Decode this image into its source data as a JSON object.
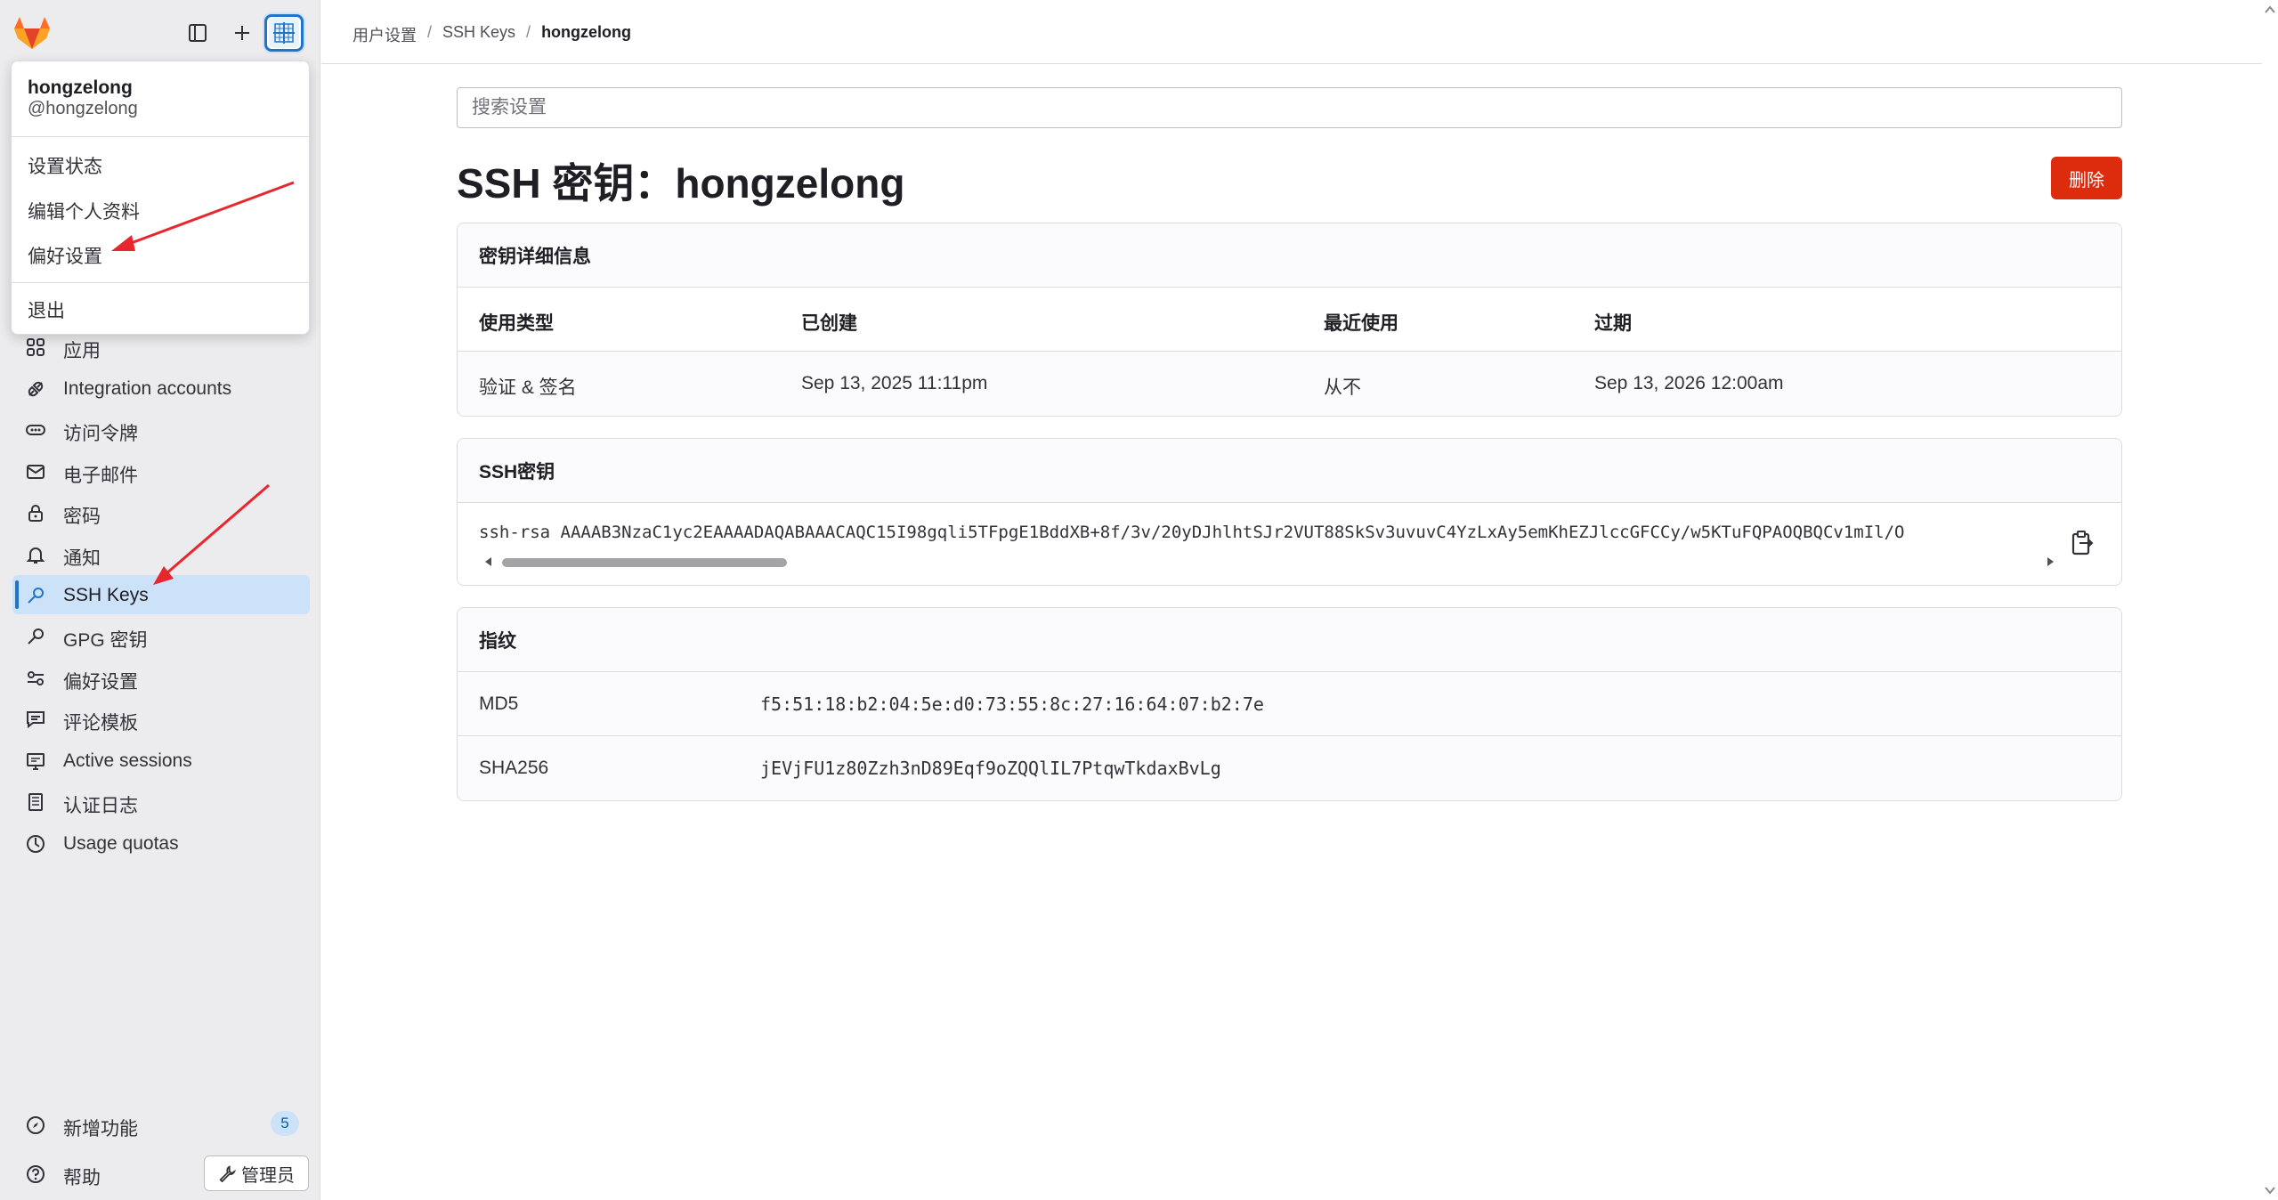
{
  "header": {
    "breadcrumbs": [
      "用户设置",
      "SSH Keys",
      "hongzelong"
    ],
    "separator": "/"
  },
  "user_menu": {
    "name": "hongzelong",
    "username": "@hongzelong",
    "items": [
      "设置状态",
      "编辑个人资料",
      "偏好设置"
    ],
    "signout": "退出"
  },
  "sidebar": {
    "items": [
      {
        "label": "应用",
        "icon": "applications-icon"
      },
      {
        "label": "Integration accounts",
        "icon": "integrations-icon"
      },
      {
        "label": "访问令牌",
        "icon": "token-icon"
      },
      {
        "label": "电子邮件",
        "icon": "mail-icon"
      },
      {
        "label": "密码",
        "icon": "lock-icon"
      },
      {
        "label": "通知",
        "icon": "notifications-icon"
      },
      {
        "label": "SSH Keys",
        "icon": "key-icon",
        "active": true
      },
      {
        "label": "GPG 密钥",
        "icon": "key-icon"
      },
      {
        "label": "偏好设置",
        "icon": "preferences-icon"
      },
      {
        "label": "评论模板",
        "icon": "comment-template-icon"
      },
      {
        "label": "Active sessions",
        "icon": "monitor-icon"
      },
      {
        "label": "认证日志",
        "icon": "log-icon"
      },
      {
        "label": "Usage quotas",
        "icon": "quota-icon"
      }
    ],
    "footer": {
      "whats_new": "新增功能",
      "whats_new_count": "5",
      "help": "帮助",
      "admin": "管理员"
    }
  },
  "main": {
    "search_placeholder": "搜索设置",
    "title": "SSH 密钥：hongzelong",
    "delete_label": "删除",
    "details": {
      "title": "密钥详细信息",
      "headers": [
        "使用类型",
        "已创建",
        "最近使用",
        "过期"
      ],
      "values": [
        "验证 & 签名",
        "Sep 13, 2025 11:11pm",
        "从不",
        "Sep 13, 2026 12:00am"
      ]
    },
    "ssh_key": {
      "title": "SSH密钥",
      "value": "ssh-rsa AAAAB3NzaC1yc2EAAAADAQABAAACAQC15I98gqli5TFpgE1BddXB+8f/3v/20yDJhlhtSJr2VUT88SkSv3uvuvC4YzLxAy5emKhEZJlccGFCCy/w5KTuFQPAOQBQCv1mIl/O"
    },
    "fingerprints": {
      "title": "指纹",
      "rows": [
        {
          "label": "MD5",
          "value": "f5:51:18:b2:04:5e:d0:73:55:8c:27:16:64:07:b2:7e"
        },
        {
          "label": "SHA256",
          "value": "jEVjFU1z80Zzh3nD89Eqf9oZQQlIL7PtqwTkdaxBvLg"
        }
      ]
    }
  },
  "colors": {
    "accent": "#1f75cb",
    "active_bg": "#cbe2f9",
    "danger": "#dd2b0e",
    "annotation": "#e8262d"
  }
}
